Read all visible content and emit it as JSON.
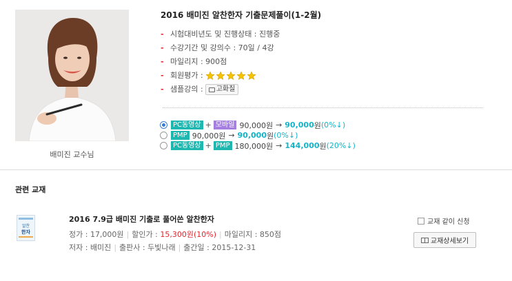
{
  "instructor": {
    "caption": "배미진 교수님"
  },
  "course": {
    "title": "2016 배미진 알찬한자 기출문제풀이(1-2월)",
    "info": [
      {
        "label": "시험대비년도 및 진행상태 : 진행중"
      },
      {
        "label": "수강기간 및 강의수 : 70일 / 4강"
      },
      {
        "label": "마일리지 : 900점"
      },
      {
        "label": "회원평가 :"
      },
      {
        "label": "샘플강의 :"
      }
    ],
    "rating": 5,
    "sample_button": "고화질",
    "star_color": "#f5c400"
  },
  "options": [
    {
      "selected": true,
      "tags": [
        "PC동영상",
        "모바일"
      ],
      "price": "90,000원",
      "arrow": "→",
      "sale": "90,000",
      "won": "원",
      "discount": "(0%↓)"
    },
    {
      "selected": false,
      "tags": [
        "PMP"
      ],
      "price": "90,000원",
      "arrow": "→",
      "sale": "90,000",
      "won": "원",
      "discount": "(0%↓)"
    },
    {
      "selected": false,
      "tags": [
        "PC동영상",
        "PMP"
      ],
      "price": "180,000원",
      "arrow": "→",
      "sale": "144,000",
      "won": "원",
      "discount": "(20%↓)"
    }
  ],
  "tag_plus": "+",
  "related": {
    "section_title": "관련 교재",
    "book": {
      "title": "2016 7.9급 배미진 기출로 풀어쓴 알찬한자",
      "list_price": "정가 : 17,000원",
      "sale_label": "할인가 : ",
      "sale_value": "15,300원(10%)",
      "mileage": "마일리지 : 850점",
      "author": "저자 : 배미진",
      "publisher": "출판사 : 두빛나래",
      "date": "출간일 : 2015-12-31",
      "separator": "|",
      "cover_text": [
        "알찬",
        "한자"
      ]
    },
    "together_label": "교재 같이 신청",
    "detail_button": "교재상세보기"
  },
  "colors": {
    "accent_red": "#e3262e",
    "price_teal": "#12b4c9",
    "tag_teal": "#1eb8b0",
    "tag_purple": "#a57fe0",
    "radio_blue": "#3a7bd5"
  }
}
